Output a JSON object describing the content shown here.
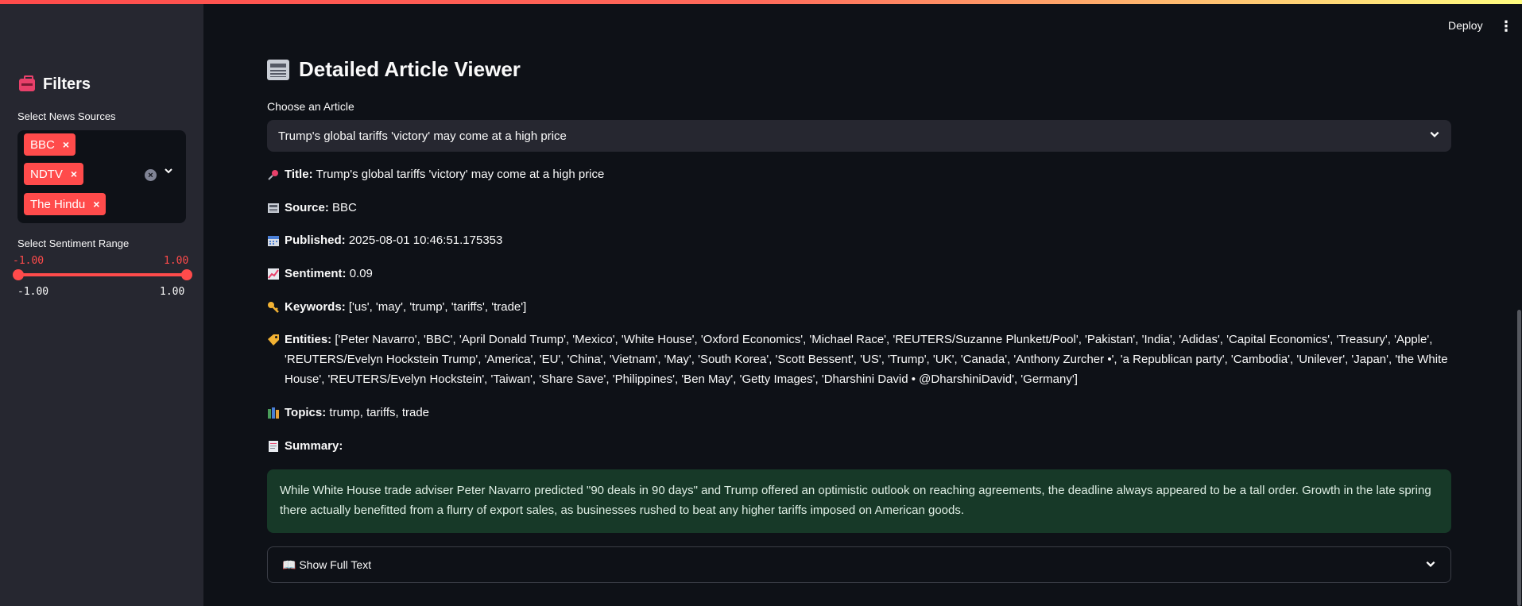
{
  "header": {
    "deploy_label": "Deploy",
    "menu_icon": "⋮"
  },
  "sidebar": {
    "heading": "Filters",
    "heading_icon": "toolbox-icon",
    "sources_label": "Select News Sources",
    "sources": [
      {
        "label": "BBC"
      },
      {
        "label": "NDTV"
      },
      {
        "label": "The Hindu"
      }
    ],
    "chip_remove": "×",
    "clear_icon": "×",
    "chevron": "⌄",
    "sentiment_label": "Select Sentiment Range",
    "sentiment_min_value": "-1.00",
    "sentiment_max_value": "1.00",
    "sentiment_range_min": "-1.00",
    "sentiment_range_max": "1.00"
  },
  "main": {
    "title": "Detailed Article Viewer",
    "choose_label": "Choose an Article",
    "selected_article": "Trump's global tariffs 'victory' may come at a high price",
    "fields": {
      "title_label": "Title:",
      "title_value": "Trump's global tariffs 'victory' may come at a high price",
      "source_label": "Source:",
      "source_value": "BBC",
      "published_label": "Published:",
      "published_value": "2025-08-01 10:46:51.175353",
      "sentiment_label": "Sentiment:",
      "sentiment_value": "0.09",
      "keywords_label": "Keywords:",
      "keywords_value": "['us', 'may', 'trump', 'tariffs', 'trade']",
      "entities_label": "Entities:",
      "entities_value": "['Peter Navarro', 'BBC', 'April Donald Trump', 'Mexico', 'White House', 'Oxford Economics', 'Michael Race', 'REUTERS/Suzanne Plunkett/Pool', 'Pakistan', 'India', 'Adidas', 'Capital Economics', 'Treasury', 'Apple', 'REUTERS/Evelyn Hockstein Trump', 'America', 'EU', 'China', 'Vietnam', 'May', 'South Korea', 'Scott Bessent', 'US', 'Trump', 'UK', 'Canada', 'Anthony Zurcher •', 'a Republican party', 'Cambodia', 'Unilever', 'Japan', 'the White House', 'REUTERS/Evelyn Hockstein', 'Taiwan', 'Share Save', 'Philippines', 'Ben May', 'Getty Images', 'Dharshini David • @DharshiniDavid', 'Germany']",
      "topics_label": "Topics:",
      "topics_value": "trump, tariffs, trade",
      "summary_label": "Summary:"
    },
    "summary_text": "While White House trade adviser Peter Navarro predicted \"90 deals in 90 days\" and Trump offered an optimistic outlook on reaching agreements, the deadline always appeared to be a tall order. Growth in the late spring there actually benefitted from a flurry of export sales, as businesses rushed to beat any higher tariffs imposed on American goods.",
    "expander_label": "📖 Show Full Text"
  },
  "colors": {
    "accent": "#ff4b4b",
    "sidebar_bg": "#262730",
    "page_bg": "#0e1117",
    "summary_bg": "#173928"
  },
  "icons": [
    "toolbox-icon",
    "newspaper-icon",
    "pushpin-icon",
    "calendar-icon",
    "chart-up-icon",
    "key-icon",
    "label-icon",
    "books-icon",
    "memo-icon",
    "book-icon",
    "chevron-down-icon",
    "kebab-menu-icon",
    "clear-icon"
  ]
}
